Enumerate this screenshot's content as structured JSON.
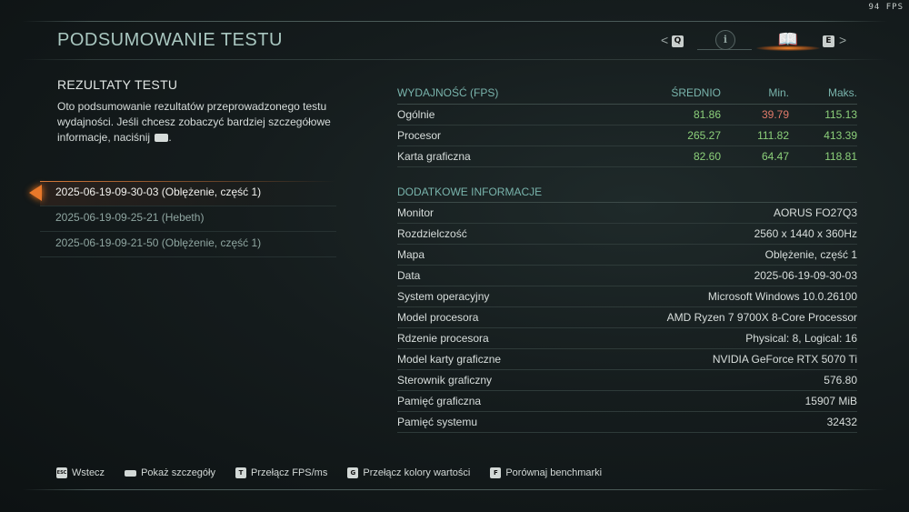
{
  "fps_counter": "94 FPS",
  "header": {
    "title": "PODSUMOWANIE TESTU",
    "prev_key": "Q",
    "next_key": "E",
    "tab1_icon": "compass-icon",
    "tab2_icon": "book-icon"
  },
  "left": {
    "section_title": "REZULTATY TESTU",
    "description": "Oto podsumowanie rezultatów przeprowadzonego testu wydajności. Jeśli chcesz zobaczyć bardziej szczegółowe informacje, naciśnij",
    "description_end": ".",
    "runs": [
      {
        "label": "2025-06-19-09-30-03 (Oblężenie, część 1)",
        "selected": true
      },
      {
        "label": "2025-06-19-09-25-21 (Hebeth)",
        "selected": false
      },
      {
        "label": "2025-06-19-09-21-50 (Oblężenie, część 1)",
        "selected": false
      }
    ]
  },
  "performance": {
    "header": {
      "name": "WYDAJNOŚĆ (FPS)",
      "avg": "ŚREDNIO",
      "min": "Min.",
      "max": "Maks."
    },
    "rows": [
      {
        "name": "Ogólnie",
        "avg": "81.86",
        "min": "39.79",
        "max": "115.13"
      },
      {
        "name": "Procesor",
        "avg": "265.27",
        "min": "111.82",
        "max": "413.39"
      },
      {
        "name": "Karta graficzna",
        "avg": "82.60",
        "min": "64.47",
        "max": "118.81"
      }
    ]
  },
  "info": {
    "title": "DODATKOWE INFORMACJE",
    "rows": [
      {
        "name": "Monitor",
        "value": "AORUS FO27Q3"
      },
      {
        "name": "Rozdzielczość",
        "value": "2560 x 1440 x 360Hz"
      },
      {
        "name": "Mapa",
        "value": "Oblężenie, część 1"
      },
      {
        "name": "Data",
        "value": "2025-06-19-09-30-03"
      },
      {
        "name": "System operacyjny",
        "value": "Microsoft Windows 10.0.26100"
      },
      {
        "name": "Model procesora",
        "value": "AMD Ryzen 7 9700X 8-Core Processor"
      },
      {
        "name": "Rdzenie procesora",
        "value": "Physical: 8, Logical: 16"
      },
      {
        "name": "Model karty graficzne",
        "value": "NVIDIA GeForce RTX 5070 Ti"
      },
      {
        "name": "Sterownik graficzny",
        "value": "576.80"
      },
      {
        "name": "Pamięć graficzna",
        "value": "15907 MiB"
      },
      {
        "name": "Pamięć systemu",
        "value": "32432"
      }
    ]
  },
  "footer": [
    {
      "key": "ESC",
      "label": "Wstecz"
    },
    {
      "key": "",
      "label": "Pokaż szczegóły"
    },
    {
      "key": "T",
      "label": "Przełącz FPS/ms"
    },
    {
      "key": "G",
      "label": "Przełącz kolory wartości"
    },
    {
      "key": "F",
      "label": "Porównaj benchmarki"
    }
  ],
  "colors": {
    "good": "#8cd07a",
    "bad": "#e07a6a",
    "accent": "#79b4ac",
    "highlight": "#e8782a"
  }
}
